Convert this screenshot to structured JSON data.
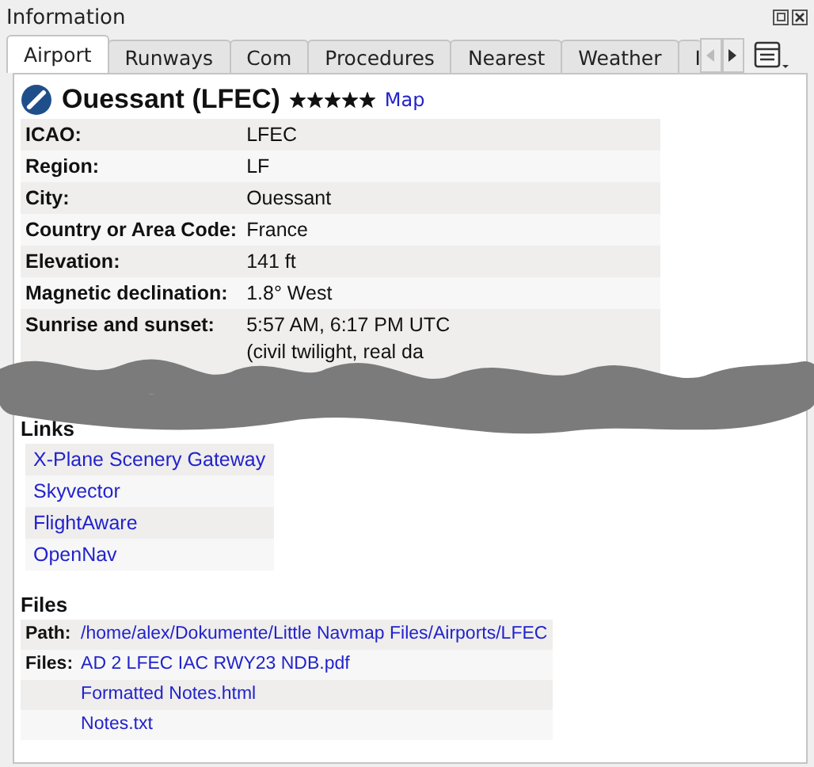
{
  "window": {
    "title": "Information"
  },
  "tabs": [
    {
      "label": "Airport",
      "selected": true
    },
    {
      "label": "Runways",
      "selected": false
    },
    {
      "label": "Com",
      "selected": false
    },
    {
      "label": "Procedures",
      "selected": false
    },
    {
      "label": "Nearest",
      "selected": false
    },
    {
      "label": "Weather",
      "selected": false
    },
    {
      "label": "I",
      "selected": false
    }
  ],
  "airport": {
    "name": "Ouessant (LFEC)",
    "stars": 5,
    "map_link": "Map"
  },
  "details": [
    {
      "label": "ICAO:",
      "value": "LFEC"
    },
    {
      "label": "Region:",
      "value": "LF"
    },
    {
      "label": "City:",
      "value": "Ouessant"
    },
    {
      "label": "Country or Area Code:",
      "value": "France"
    },
    {
      "label": "Elevation:",
      "value": "141 ft"
    },
    {
      "label": "Magnetic declination:",
      "value": "1.8° West"
    },
    {
      "label": "Sunrise and sunset:",
      "value": "5:57 AM, 6:17 PM UTC",
      "note": "(civil twilight, real da"
    }
  ],
  "links": {
    "heading": "Links",
    "items": [
      "X-Plane Scenery Gateway",
      "Skyvector",
      "FlightAware",
      "OpenNav"
    ]
  },
  "files": {
    "heading": "Files",
    "path_label": "Path:",
    "path": "/home/alex/Dokumente/Little Navmap Files/Airports/LFEC",
    "files_label": "Files:",
    "items": [
      "AD 2 LFEC IAC RWY23 NDB.pdf",
      "Formatted Notes.html",
      "Notes.txt"
    ]
  }
}
